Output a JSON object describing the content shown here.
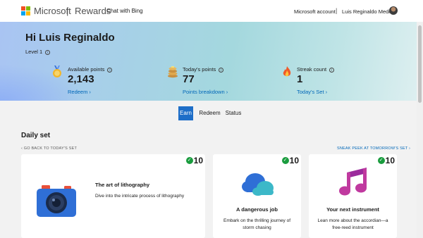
{
  "header": {
    "brand": "Microsoft",
    "separator": "|",
    "product": "Rewards",
    "chat_link": "Chat with Bing",
    "account_link": "Microsoft account",
    "account_separator": "|",
    "user_name": "Luis Reginaldo Medilo"
  },
  "hero": {
    "greeting": "Hi Luis Reginaldo",
    "level": "Level 1",
    "stats": [
      {
        "icon": "medal-icon",
        "label": "Available points",
        "value": "2,143",
        "link": "Redeem ›"
      },
      {
        "icon": "pancake-stack-icon",
        "label": "Today's points",
        "value": "77",
        "link": "Points breakdown ›"
      },
      {
        "icon": "flame-icon",
        "label": "Streak count",
        "value": "1",
        "link": "Today's Set ›"
      }
    ]
  },
  "tabs": [
    {
      "label": "Earn",
      "active": true
    },
    {
      "label": "Redeem",
      "active": false
    },
    {
      "label": "Status",
      "active": false
    }
  ],
  "daily_set": {
    "heading": "Daily set",
    "back_link": "‹ GO BACK TO TODAY'S SET",
    "peek_link": "SNEAK PEEK AT TOMORROW'S SET ›",
    "cards": [
      {
        "icon": "camera-icon",
        "points": "10",
        "title": "The art of lithography",
        "description": "Dive into the intricate process of lithography"
      },
      {
        "icon": "storm-cloud-icon",
        "points": "10",
        "title": "A dangerous job",
        "description": "Embark on the thrilling journey of storm chasing"
      },
      {
        "icon": "music-note-icon",
        "points": "10",
        "title": "Your next instrument",
        "description": "Lean more about the accordian—a free-reed instrument"
      }
    ]
  },
  "colors": {
    "accent": "#1e6ec8",
    "link": "#0067b8",
    "check": "#1a9c3e",
    "ms_red": "#f25022",
    "ms_green": "#7fba00",
    "ms_blue": "#00a4ef",
    "ms_yellow": "#ffb900"
  }
}
